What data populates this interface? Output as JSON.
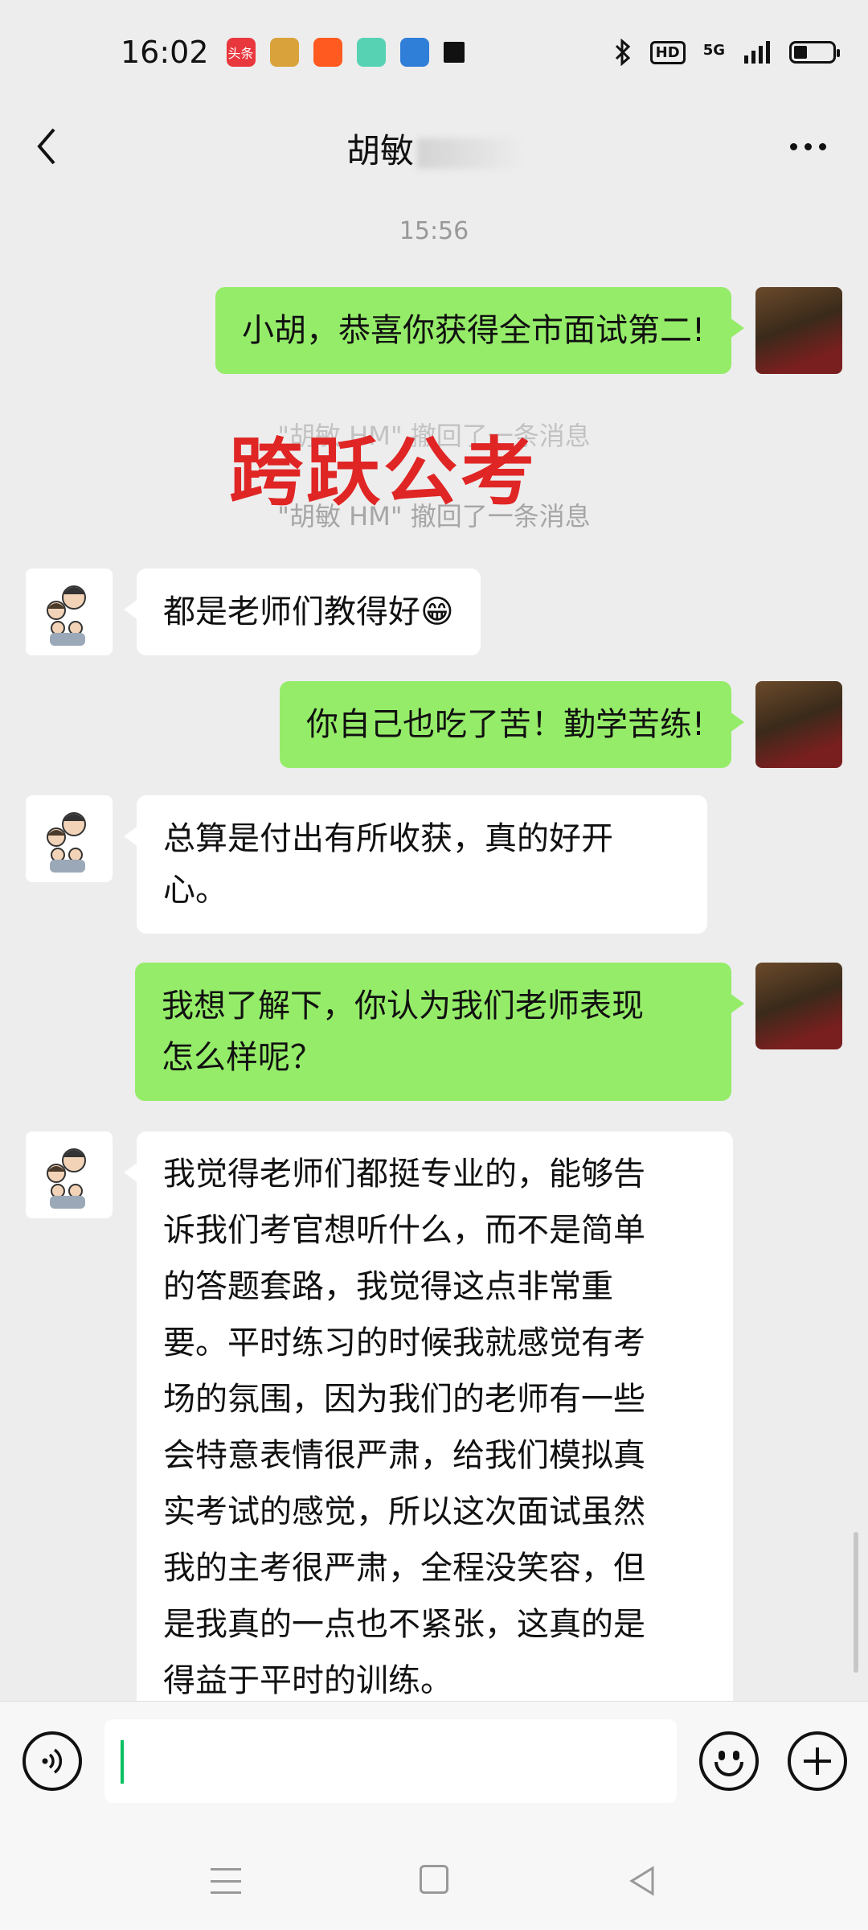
{
  "status_bar": {
    "time": "16:02",
    "notification_icons": [
      {
        "icon": "toutiao-app-icon",
        "label": "头条",
        "color": "#e8383d"
      },
      {
        "icon": "cat-app-icon",
        "color": "#d9a23a"
      },
      {
        "icon": "kuaishou-app-icon",
        "color": "#ff5a1f"
      },
      {
        "icon": "notes-app-icon",
        "color": "#57d3b4"
      },
      {
        "icon": "cloud-app-icon",
        "color": "#2f7fd8"
      },
      {
        "icon": "square-icon",
        "color": "#111111"
      }
    ],
    "network": "5G",
    "hd_label": "HD"
  },
  "nav": {
    "title": "胡敏"
  },
  "chat": {
    "timestamp": "15:56",
    "watermark": "跨跃公考",
    "recall_notice": "\"胡敏 HM\" 撤回了一条消息",
    "messages": [
      {
        "from": "me",
        "text": "小胡，恭喜你获得全市面试第二!"
      },
      {
        "from": "other",
        "text": "都是老师们教得好😁"
      },
      {
        "from": "me",
        "text": "你自己也吃了苦！勤学苦练!"
      },
      {
        "from": "other",
        "lines": [
          "总算是付出有所收获，真的好开",
          "心。"
        ]
      },
      {
        "from": "me",
        "lines": [
          "我想了解下，你认为我们老师表现",
          "怎么样呢？"
        ]
      },
      {
        "from": "other",
        "lines": [
          "我觉得老师们都挺专业的，能够告",
          "诉我们考官想听什么，而不是简单",
          "的答题套路，我觉得这点非常重",
          "要。平时练习的时候我就感觉有考",
          "场的氛围，因为我们的老师有一些",
          "会特意表情很严肃，给我们模拟真",
          "实考试的感觉，所以这次面试虽然",
          "我的主考很严肃，全程没笑容，但",
          "是我真的一点也不紧张，这真的是",
          "得益于平时的训练。"
        ]
      }
    ]
  },
  "input": {
    "value": "",
    "accent": "#07c160"
  },
  "colors": {
    "my_bubble": "#95ec69",
    "other_bubble": "#ffffff",
    "background": "#ededed",
    "watermark": "#e02525"
  }
}
